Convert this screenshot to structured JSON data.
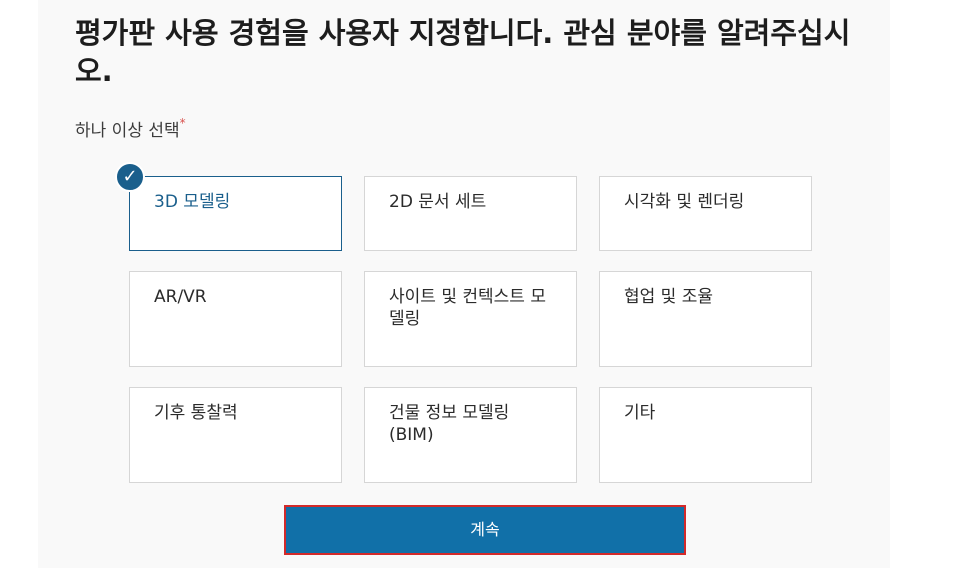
{
  "heading": "평가판 사용 경험을 사용자 지정합니다. 관심 분야를 알려주십시오.",
  "subtitle": "하나 이상 선택",
  "required_mark": "*",
  "check_icon": "✓",
  "options": [
    {
      "label": "3D 모델링",
      "selected": true
    },
    {
      "label": "2D 문서 세트",
      "selected": false
    },
    {
      "label": "시각화 및 렌더링",
      "selected": false
    },
    {
      "label": "AR/VR",
      "selected": false
    },
    {
      "label": "사이트 및 컨텍스트 모델링",
      "selected": false
    },
    {
      "label": "협업 및 조율",
      "selected": false
    },
    {
      "label": "기후 통찰력",
      "selected": false
    },
    {
      "label": "건물 정보 모델링 (BIM)",
      "selected": false
    },
    {
      "label": "기타",
      "selected": false
    }
  ],
  "continue_label": "계속",
  "colors": {
    "accent": "#1a5f8c",
    "button": "#1170a8",
    "button_outline": "#d32a2a",
    "required": "#d9534f"
  }
}
